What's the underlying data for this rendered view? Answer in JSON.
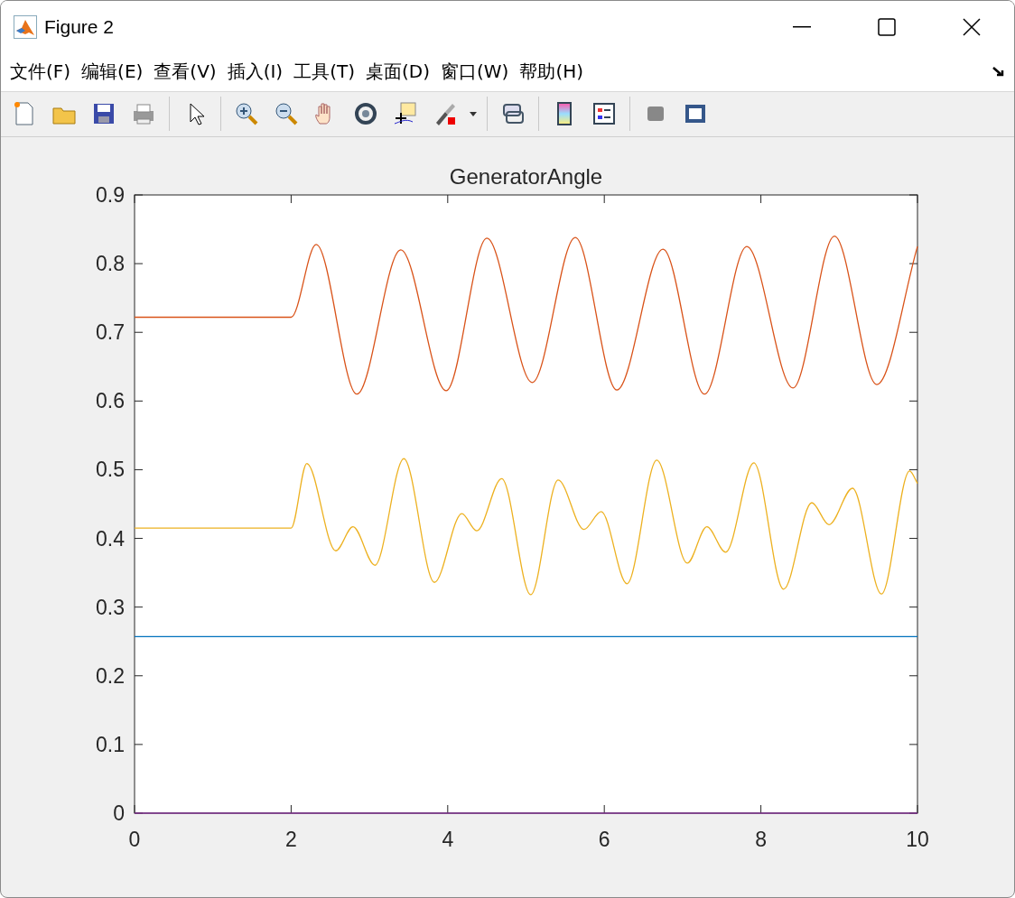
{
  "window": {
    "title": "Figure 2"
  },
  "menu": [
    "文件(F)",
    "编辑(E)",
    "查看(V)",
    "插入(I)",
    "工具(T)",
    "桌面(D)",
    "窗口(W)",
    "帮助(H)"
  ],
  "chart_data": {
    "type": "line",
    "title": "GeneratorAngle",
    "xlim": [
      0,
      10
    ],
    "ylim": [
      0,
      0.9
    ],
    "xticks": [
      {
        "value": 0,
        "label": "0"
      },
      {
        "value": 2,
        "label": "2"
      },
      {
        "value": 4,
        "label": "4"
      },
      {
        "value": 6,
        "label": "6"
      },
      {
        "value": 8,
        "label": "8"
      },
      {
        "value": 10,
        "label": "10"
      }
    ],
    "yticks": [
      {
        "value": 0,
        "label": "0"
      },
      {
        "value": 0.1,
        "label": "0.1"
      },
      {
        "value": 0.2,
        "label": "0.2"
      },
      {
        "value": 0.3,
        "label": "0.3"
      },
      {
        "value": 0.4,
        "label": "0.4"
      },
      {
        "value": 0.5,
        "label": "0.5"
      },
      {
        "value": 0.6,
        "label": "0.6"
      },
      {
        "value": 0.7,
        "label": "0.7"
      },
      {
        "value": 0.8,
        "label": "0.8"
      },
      {
        "value": 0.9,
        "label": "0.9"
      }
    ],
    "series": [
      {
        "color": "#0072bd",
        "x": [
          0,
          10
        ],
        "values": [
          0.257,
          0.257
        ]
      },
      {
        "color": "#d95319",
        "x": [
          0,
          2,
          2.32,
          2.84,
          3.4,
          3.98,
          4.5,
          5.08,
          5.63,
          6.16,
          6.75,
          7.28,
          7.82,
          8.41,
          8.94,
          9.48,
          10
        ],
        "values": [
          0.722,
          0.722,
          0.828,
          0.61,
          0.82,
          0.615,
          0.837,
          0.627,
          0.838,
          0.616,
          0.821,
          0.61,
          0.825,
          0.619,
          0.84,
          0.624,
          0.825
        ]
      },
      {
        "color": "#edb120",
        "x": [
          0,
          2,
          2.2,
          2.57,
          2.79,
          3.07,
          3.44,
          3.83,
          4.18,
          4.37,
          4.69,
          5.06,
          5.41,
          5.74,
          5.96,
          6.29,
          6.67,
          7.06,
          7.31,
          7.55,
          7.91,
          8.29,
          8.65,
          8.87,
          9.17,
          9.54,
          9.9,
          10
        ],
        "values": [
          0.415,
          0.415,
          0.509,
          0.382,
          0.417,
          0.361,
          0.516,
          0.336,
          0.436,
          0.411,
          0.487,
          0.318,
          0.485,
          0.413,
          0.439,
          0.334,
          0.514,
          0.364,
          0.417,
          0.38,
          0.51,
          0.326,
          0.452,
          0.42,
          0.473,
          0.319,
          0.498,
          0.48
        ]
      },
      {
        "color": "#7e2f8e",
        "x": [
          0,
          10
        ],
        "values": [
          0,
          0
        ]
      }
    ]
  }
}
